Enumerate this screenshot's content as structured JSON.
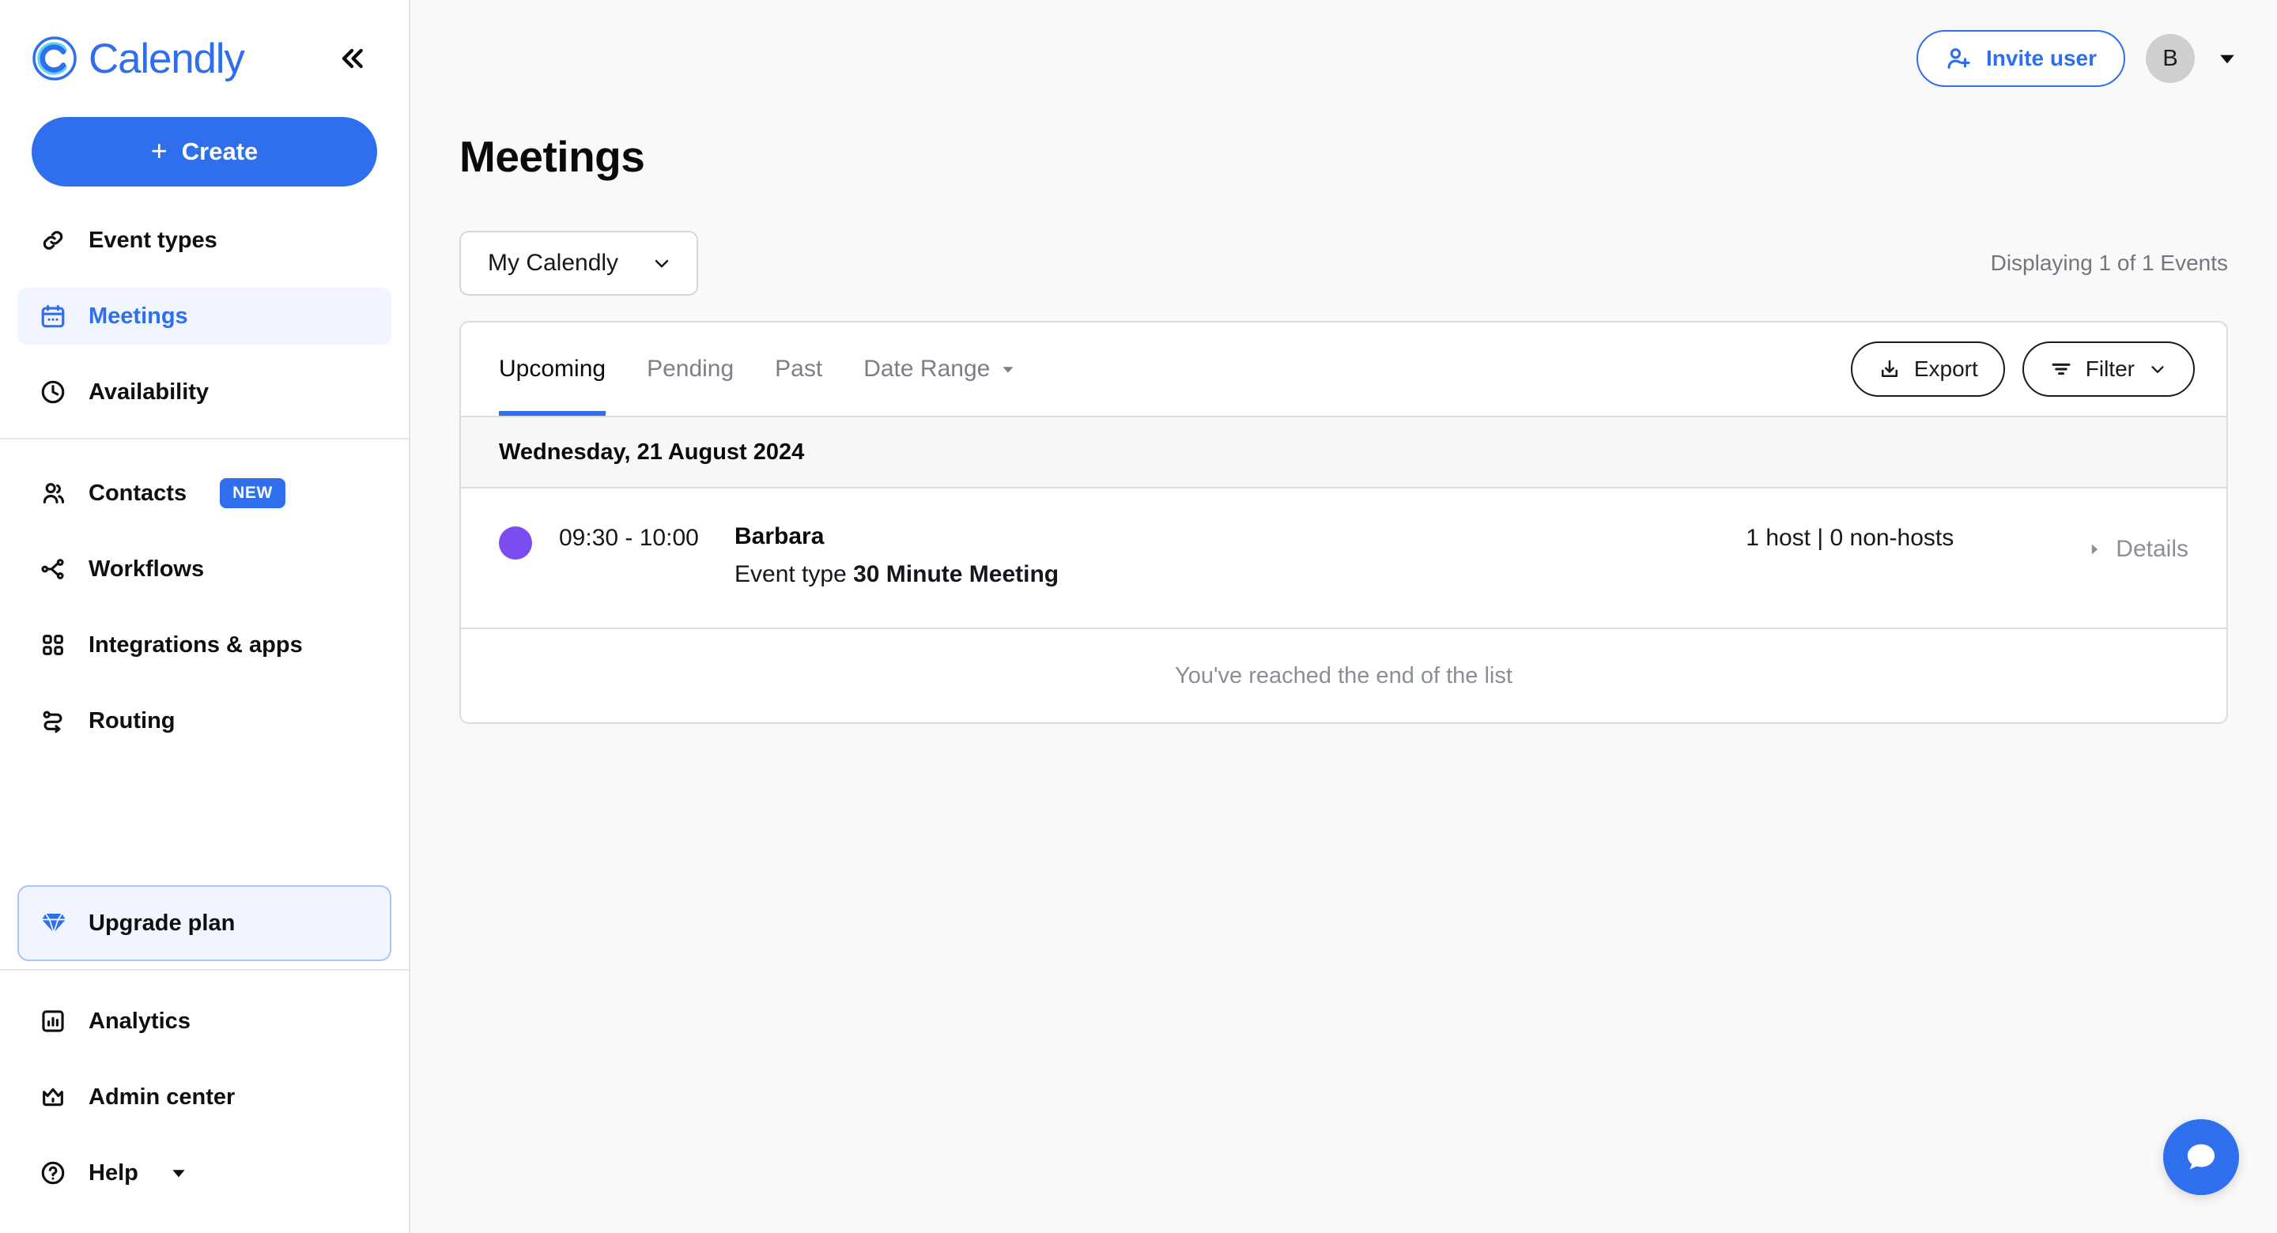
{
  "sidebar": {
    "logo_text": "Calendly",
    "collapse_label": "«",
    "create_label": "Create",
    "nav_primary": [
      {
        "label": "Event types",
        "icon": "link-icon",
        "active": false
      },
      {
        "label": "Meetings",
        "icon": "calendar-icon",
        "active": true
      },
      {
        "label": "Availability",
        "icon": "clock-icon",
        "active": false
      }
    ],
    "nav_secondary": [
      {
        "label": "Contacts",
        "icon": "people-icon",
        "badge": "NEW"
      },
      {
        "label": "Workflows",
        "icon": "workflow-icon",
        "badge": ""
      },
      {
        "label": "Integrations & apps",
        "icon": "grid-icon",
        "badge": ""
      },
      {
        "label": "Routing",
        "icon": "routing-icon",
        "badge": ""
      }
    ],
    "upgrade": {
      "label": "Upgrade plan",
      "icon": "diamond-icon"
    },
    "nav_bottom": [
      {
        "label": "Analytics",
        "icon": "analytics-icon",
        "caret": false
      },
      {
        "label": "Admin center",
        "icon": "crown-icon",
        "caret": false
      },
      {
        "label": "Help",
        "icon": "question-circle-icon",
        "caret": true
      }
    ]
  },
  "header": {
    "invite_label": "Invite user",
    "avatar_initial": "B"
  },
  "page": {
    "title": "Meetings",
    "calendly_selector": "My Calendly",
    "displaying": "Displaying 1 of 1 Events"
  },
  "card": {
    "tabs": [
      {
        "label": "Upcoming",
        "active": true,
        "caret": false
      },
      {
        "label": "Pending",
        "active": false,
        "caret": false
      },
      {
        "label": "Past",
        "active": false,
        "caret": false
      },
      {
        "label": "Date Range",
        "active": false,
        "caret": true
      }
    ],
    "export_label": "Export",
    "filter_label": "Filter",
    "date_header": "Wednesday, 21 August 2024",
    "meetings": [
      {
        "dot_color": "#7b4cf0",
        "time": "09:30 - 10:00",
        "invitee": "Barbara",
        "event_type_prefix": "Event type ",
        "event_type_name": "30 Minute Meeting",
        "hosts": "1 host | 0 non-hosts",
        "details_label": "Details"
      }
    ],
    "end_of_list": "You've reached the end of the list"
  },
  "chat": {
    "icon": "chat-bubble-icon"
  },
  "colors": {
    "accent": "#2f6fed",
    "dot_purple": "#7b4cf0",
    "active_nav_bg": "#f0f5ff",
    "page_bg": "#f9f9f9"
  }
}
